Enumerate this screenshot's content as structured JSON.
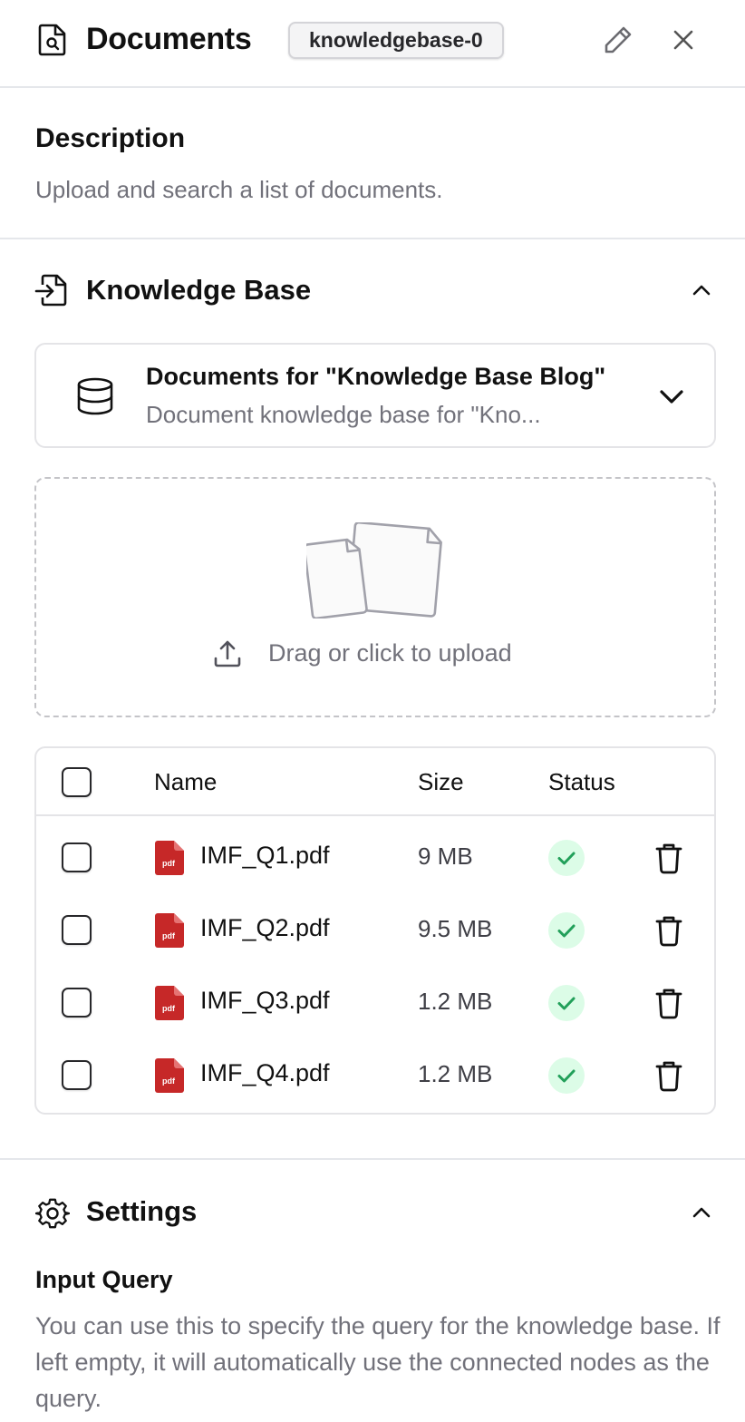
{
  "header": {
    "title": "Documents",
    "node_id": "knowledgebase-0",
    "icons": {
      "doc": "document-search-icon",
      "edit": "pencil-icon",
      "close": "close-icon"
    }
  },
  "description": {
    "heading": "Description",
    "text": "Upload and search a list of documents."
  },
  "knowledge_base": {
    "heading": "Knowledge Base",
    "selected": {
      "title": "Documents for \"Knowledge Base Blog\"",
      "subtitle": "Document knowledge base for \"Kno..."
    },
    "upload_label": "Drag or click to upload"
  },
  "table": {
    "columns": {
      "name": "Name",
      "size": "Size",
      "status": "Status"
    },
    "rows": [
      {
        "name": "IMF_Q1.pdf",
        "size": "9 MB",
        "status": "done"
      },
      {
        "name": "IMF_Q2.pdf",
        "size": "9.5 MB",
        "status": "done"
      },
      {
        "name": "IMF_Q3.pdf",
        "size": "1.2 MB",
        "status": "done"
      },
      {
        "name": "IMF_Q4.pdf",
        "size": "1.2 MB",
        "status": "done"
      }
    ],
    "pdf_icon_label": "pdf"
  },
  "settings": {
    "heading": "Settings",
    "input_query": {
      "label": "Input Query",
      "help": "You can use this to specify the query for the knowledge base. If left empty, it will automatically use the connected nodes as the query."
    }
  },
  "colors": {
    "pdf_red": "#c62828",
    "status_bg": "#dcfce7",
    "status_check": "#22a05a",
    "muted_text": "#71717a"
  }
}
